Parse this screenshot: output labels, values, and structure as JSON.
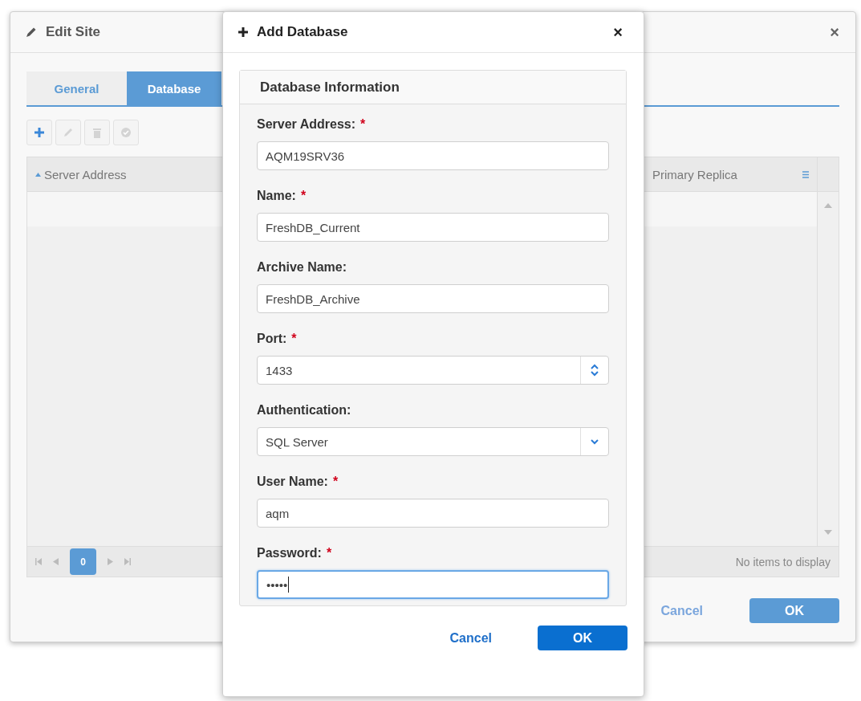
{
  "edit_site": {
    "title": "Edit Site",
    "close": "×",
    "tabs": [
      {
        "label": "General",
        "selected": false
      },
      {
        "label": "Database",
        "selected": true
      }
    ],
    "toolbar": [
      {
        "kind": "add",
        "disabled": false
      },
      {
        "kind": "edit",
        "disabled": true
      },
      {
        "kind": "delete",
        "disabled": true
      },
      {
        "kind": "check",
        "disabled": true
      }
    ],
    "grid": {
      "columns": [
        {
          "label": "Server Address",
          "sorted": true
        },
        {
          "label": "Primary Replica",
          "sorted": false
        }
      ],
      "page": "0",
      "status": "No items to display"
    },
    "buttons": [
      {
        "kind": "link",
        "label": "Cancel"
      },
      {
        "kind": "primary",
        "label": "OK"
      }
    ]
  },
  "add_database": {
    "title": "Add Database",
    "close": "×",
    "section": "Database Information",
    "required_mark": "*",
    "fields": [
      {
        "label": "Server Address:",
        "required": true,
        "kind": "text",
        "value": "AQM19SRV36",
        "focused": false
      },
      {
        "label": "Name:",
        "required": true,
        "kind": "text",
        "value": "FreshDB_Current",
        "focused": false
      },
      {
        "label": "Archive Name:",
        "required": false,
        "kind": "text",
        "value": "FreshDB_Archive",
        "focused": false
      },
      {
        "label": "Port:",
        "required": true,
        "kind": "number",
        "value": "1433",
        "focused": false
      },
      {
        "label": "Authentication:",
        "required": false,
        "kind": "select",
        "value": "SQL Server",
        "focused": false
      },
      {
        "label": "User Name:",
        "required": true,
        "kind": "text",
        "value": "aqm",
        "focused": false
      },
      {
        "label": "Password:",
        "required": true,
        "kind": "password",
        "value": "•••••",
        "focused": true
      }
    ],
    "buttons": [
      {
        "kind": "link",
        "label": "Cancel"
      },
      {
        "kind": "primary",
        "label": "OK"
      }
    ]
  }
}
